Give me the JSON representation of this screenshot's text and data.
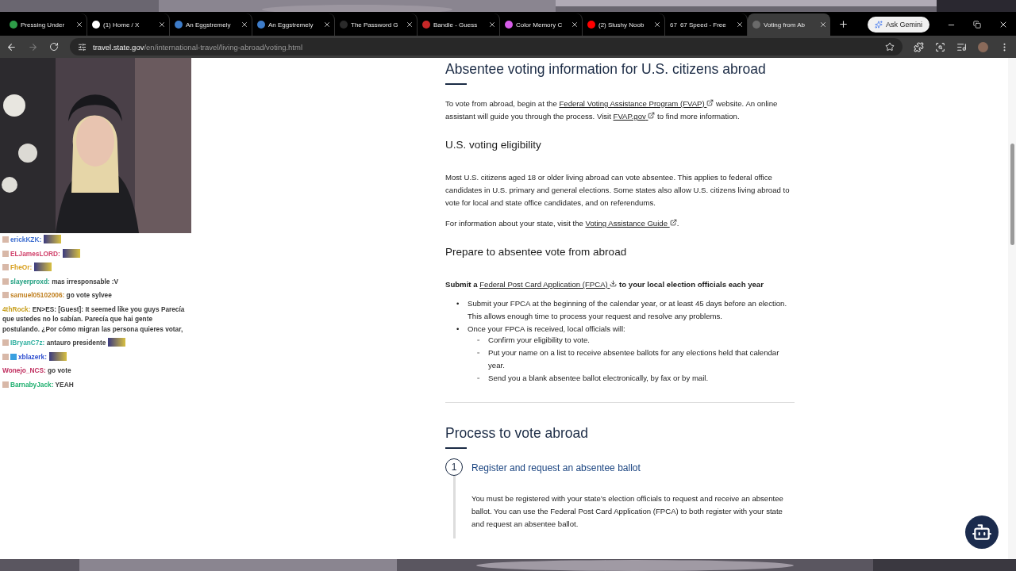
{
  "tabs": [
    {
      "title": "Pressing Under",
      "selected": false,
      "color": "#2e9d48"
    },
    {
      "title": "(1) Home / X",
      "selected": false,
      "color": "#ffffff"
    },
    {
      "title": "An Eggstremely",
      "selected": false,
      "color": "#3d7cc9"
    },
    {
      "title": "An Eggstremely",
      "selected": false,
      "color": "#3d7cc9"
    },
    {
      "title": "The Password G",
      "selected": false,
      "color": "#2a2a2a"
    },
    {
      "title": "Bandle - Guess",
      "selected": false,
      "color": "#c62828"
    },
    {
      "title": "Color Memory C",
      "selected": false,
      "color": "#d65ce8"
    },
    {
      "title": "(2) Slushy Noob",
      "selected": false,
      "color": "#ff0000"
    },
    {
      "title": "67 Speed - Free",
      "selected": false,
      "favicon_text": "67"
    },
    {
      "title": "Voting from Ab",
      "selected": true,
      "color": "#6a6a6a"
    }
  ],
  "gemini_button": "Ask Gemini",
  "address": {
    "host": "travel.state.gov",
    "path": "/en/international-travel/living-abroad/voting.html"
  },
  "chat": [
    {
      "user": "erickKZK:",
      "color": "#3f6fd0",
      "badge": true,
      "extra_badge": false,
      "emote": true
    },
    {
      "user": "ELJamesLORD:",
      "color": "#d0406a",
      "badge": true,
      "extra_badge": false,
      "emote": true
    },
    {
      "user": "FheOr:",
      "color": "#d8a020",
      "badge": true,
      "extra_badge": false,
      "emote": true
    },
    {
      "user": "slayerproxd:",
      "color": "#20a080",
      "badge": true,
      "extra_badge": false,
      "message": "mas irresponsable :V",
      "emote": false
    },
    {
      "user": "samuel05102006:",
      "color": "#c08020",
      "badge": true,
      "extra_badge": false,
      "message": "go vote sylvee",
      "emote": false
    },
    {
      "user": "4thRock:",
      "color": "#c8a020",
      "badge": false,
      "extra_badge": false,
      "message": "EN>ES: [Guest]: It seemed like you guys Parecía que ustedes no lo sabían. Parecía que hai gente postulando. ¿Por cómo migran las persona quieres votar,",
      "emote": false
    },
    {
      "user": "IBryanC7z:",
      "color": "#30b0a0",
      "badge": true,
      "extra_badge": false,
      "message": "antauro presidente",
      "emote": true
    },
    {
      "user": "xblazerk:",
      "color": "#3050d0",
      "badge": true,
      "extra_badge": true,
      "emote": true
    },
    {
      "user": "Wonejo_NCS:",
      "color": "#c03060",
      "badge": false,
      "extra_badge": false,
      "message": "go vote",
      "emote": false
    },
    {
      "user": "BarnabyJack:",
      "color": "#20b070",
      "badge": true,
      "extra_badge": false,
      "message": "YEAH",
      "emote": false
    }
  ],
  "article": [
    {
      "kind": "title",
      "text": "Absentee voting information for U.S. citizens abroad"
    },
    {
      "kind": "paragraph",
      "parts": [
        {
          "kind": "text",
          "text": "To vote from abroad, begin at the "
        },
        {
          "kind": "external_link",
          "text": "Federal Voting Assistance Program (FVAP)"
        },
        {
          "kind": "text",
          "text": " website. An online assistant will guide you through the process. Visit "
        },
        {
          "kind": "external_link",
          "text": "FVAP.gov"
        },
        {
          "kind": "text",
          "text": " to find more information."
        }
      ]
    },
    {
      "kind": "heading",
      "text": "U.S. voting eligibility"
    },
    {
      "kind": "paragraph",
      "parts": [
        {
          "kind": "text",
          "text": "Most U.S. citizens aged 18 or older living abroad can vote absentee. This applies to federal office candidates in U.S. primary and general elections. Some states also allow U.S. citizens living abroad to vote for local and state office candidates, and on referendums."
        }
      ]
    },
    {
      "kind": "paragraph",
      "parts": [
        {
          "kind": "text",
          "text": "For information about your state, visit the "
        },
        {
          "kind": "external_link",
          "text": "Voting Assistance Guide"
        },
        {
          "kind": "text",
          "text": "."
        }
      ]
    },
    {
      "kind": "heading",
      "text": "Prepare to absentee vote from abroad"
    },
    {
      "kind": "strong",
      "parts": [
        {
          "kind": "text",
          "text": "Submit a "
        },
        {
          "kind": "download_link",
          "text": "Federal Post Card Application (FPCA)"
        },
        {
          "kind": "text",
          "text": " to your local election officials each year"
        }
      ]
    },
    {
      "kind": "list",
      "items": [
        {
          "marker": "•",
          "text": "Submit your FPCA at the beginning of the calendar year, or at least 45 days before an election. This allows enough time to process your request and resolve any problems."
        },
        {
          "marker": "•",
          "text": "Once your FPCA is received, local officials will:",
          "children": [
            {
              "marker": "◦",
              "text": "Confirm your eligibility to vote."
            },
            {
              "marker": "◦",
              "text": "Put your name on a list to receive absentee ballots for any elections held that calendar year."
            },
            {
              "marker": "◦",
              "text": "Send you a blank absentee ballot electronically, by fax or by mail."
            }
          ]
        }
      ]
    },
    {
      "kind": "rule"
    },
    {
      "kind": "title",
      "text": "Process to vote abroad"
    },
    {
      "kind": "step",
      "number": "1",
      "title": "Register and request an absentee ballot",
      "text": "You must be registered with your state’s election officials to request and receive an absentee ballot. You can use the Federal Post Card Application (FPCA) to both register with your state and request an absentee ballot."
    }
  ]
}
